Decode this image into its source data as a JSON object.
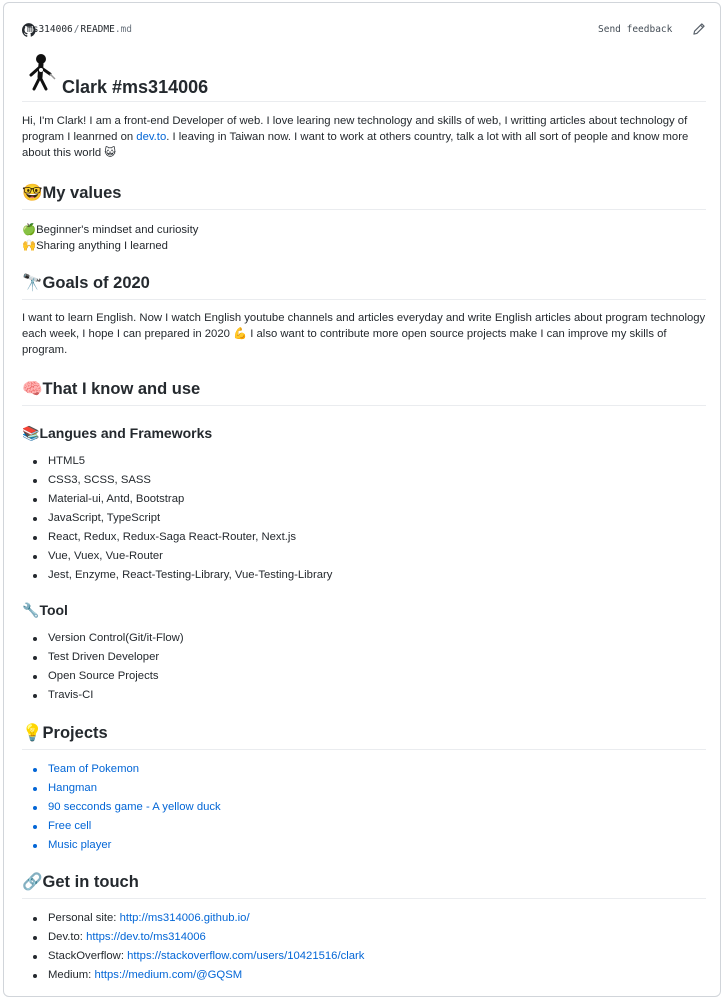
{
  "header": {
    "repo_owner": "ms314006",
    "separator": "/",
    "file_base": "README",
    "file_ext": ".md",
    "feedback_label": "Send feedback",
    "icons": {
      "brand": "github-octocat-icon",
      "edit": "pencil-icon"
    }
  },
  "profile": {
    "title": "Clark #ms314006",
    "avatar_icon": "stick-figure-avatar-icon"
  },
  "intro": {
    "text_before_link": "Hi, I'm Clark! I am a front-end Developer of web. I love learing new technology and skills of web, I writting articles about technology of program I leanrned on ",
    "link_text": "dev.to",
    "text_after_link": ". I leaving in Taiwan now. I want to work at others country, talk a lot with all sort of people and know more about this world",
    "emoji": "😺"
  },
  "values": {
    "emoji": "🤓",
    "heading": "My values",
    "items": [
      {
        "emoji": "🍏",
        "text": "Beginner's mindset and curiosity"
      },
      {
        "emoji": "🙌",
        "text": "Sharing anything I learned"
      }
    ]
  },
  "goals": {
    "emoji": "🔭",
    "heading": "Goals of 2020",
    "text_before_emoji": "I want to learn English. Now I watch English youtube channels and articles everyday and write English articles about program technology each week, I hope I can prepared in 2020",
    "emoji_inline": "💪",
    "text_after_emoji": " I also want to contribute more open source projects make I can improve my skills of program."
  },
  "know": {
    "emoji": "🧠",
    "heading": "That I know and use",
    "langs": {
      "emoji": "📚",
      "heading": "Langues and Frameworks",
      "items": [
        "HTML5",
        "CSS3, SCSS, SASS",
        "Material-ui, Antd, Bootstrap",
        "JavaScript, TypeScript",
        "React, Redux, Redux-Saga React-Router, Next.js",
        "Vue, Vuex, Vue-Router",
        "Jest, Enzyme, React-Testing-Library, Vue-Testing-Library"
      ]
    },
    "tool": {
      "emoji": "🔧",
      "heading": "Tool",
      "items": [
        "Version Control(Git/it-Flow)",
        "Test Driven Developer",
        "Open Source Projects",
        "Travis-CI"
      ]
    }
  },
  "projects": {
    "emoji": "💡",
    "heading": "Projects",
    "items": [
      "Team of Pokemon",
      "Hangman",
      "90 secconds game - A yellow duck",
      "Free cell",
      "Music player"
    ]
  },
  "contact": {
    "emoji": "🔗",
    "heading": "Get in touch",
    "items": [
      {
        "label": "Personal site: ",
        "url": "http://ms314006.github.io/"
      },
      {
        "label": "Dev.to: ",
        "url": "https://dev.to/ms314006"
      },
      {
        "label": "StackOverflow: ",
        "url": "https://stackoverflow.com/users/10421516/clark"
      },
      {
        "label": "Medium: ",
        "url": "https://medium.com/@GQSM"
      }
    ]
  }
}
